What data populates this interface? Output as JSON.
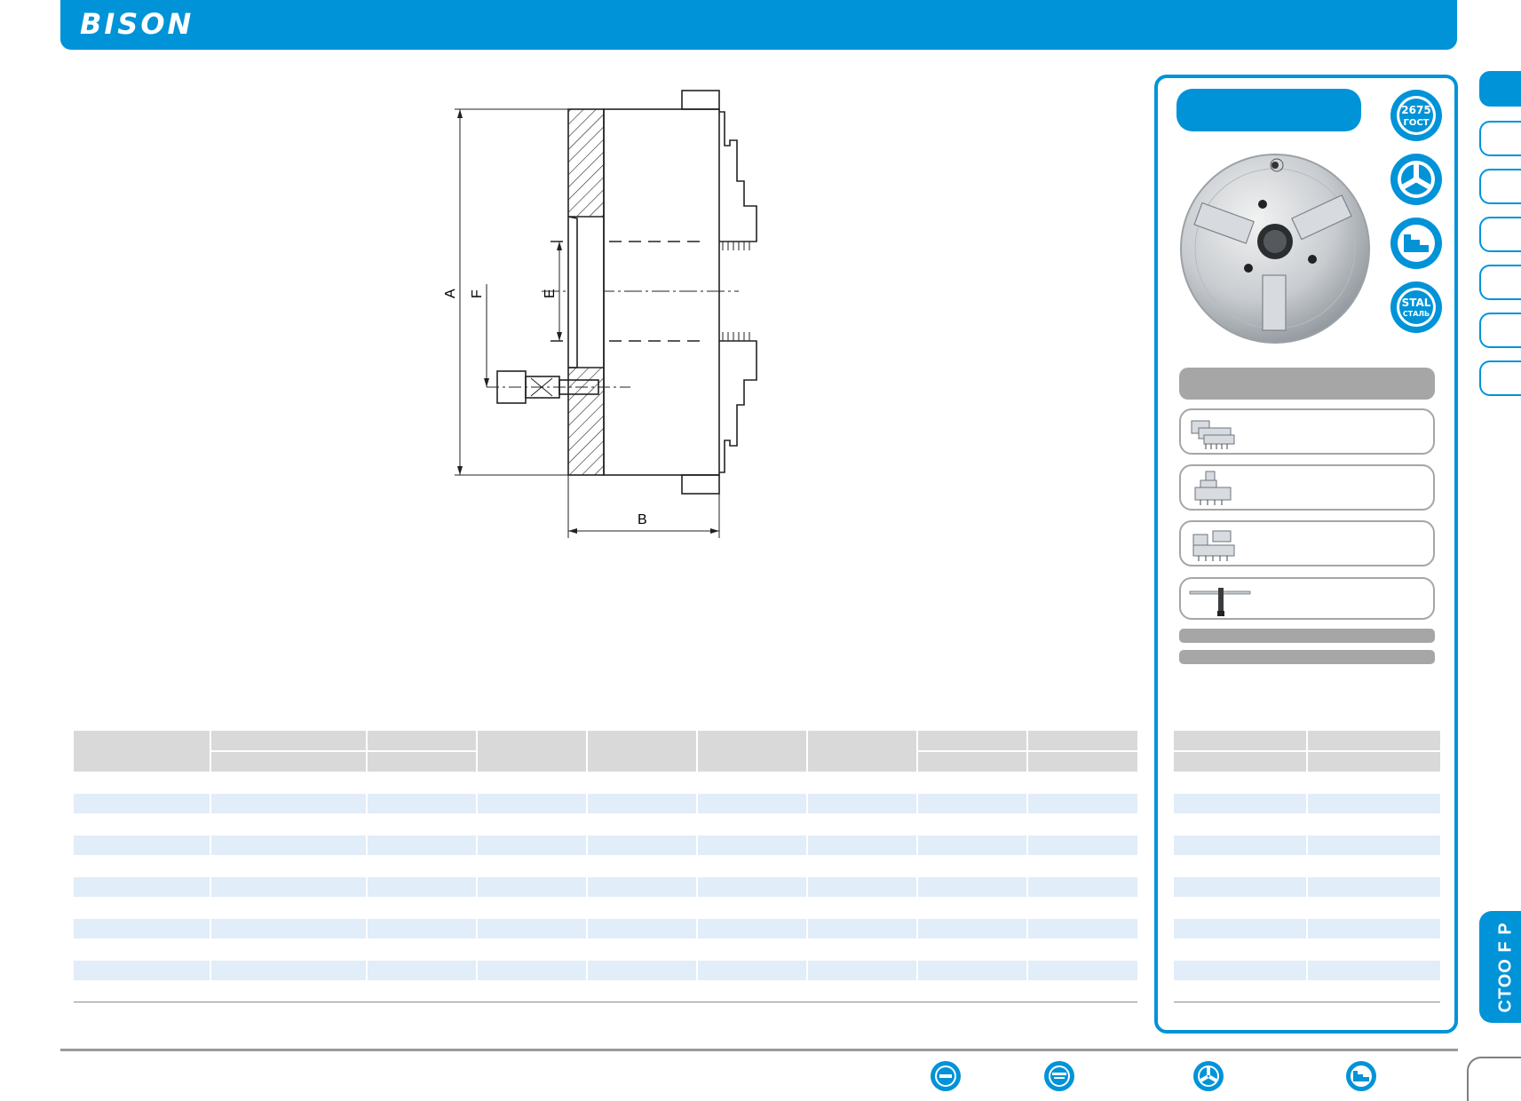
{
  "header": {
    "logo_text": "BISON",
    "color": "#0093d8"
  },
  "drawing": {
    "dimension_labels": {
      "a": "A",
      "b": "B",
      "e": "E",
      "f": "F"
    }
  },
  "badges": [
    {
      "name": "gost-badge",
      "line1": "2675",
      "line2": "ГОСТ"
    },
    {
      "name": "three-jaw-badge"
    },
    {
      "name": "jaw-profile-badge"
    },
    {
      "name": "steel-badge",
      "line1": "STAL",
      "line2": "СТАЛЬ"
    }
  ],
  "side_tab": {
    "code": "CTOO F P"
  },
  "colors": {
    "accent": "#0093d8",
    "table_stripe": "#e1edf8",
    "table_header": "#d9d9d9",
    "panel_gray": "#a6a6a6"
  },
  "icons": [
    "gost-icon",
    "stahl-steel-icon",
    "three-jaw-icon",
    "jaw-profile-icon"
  ]
}
